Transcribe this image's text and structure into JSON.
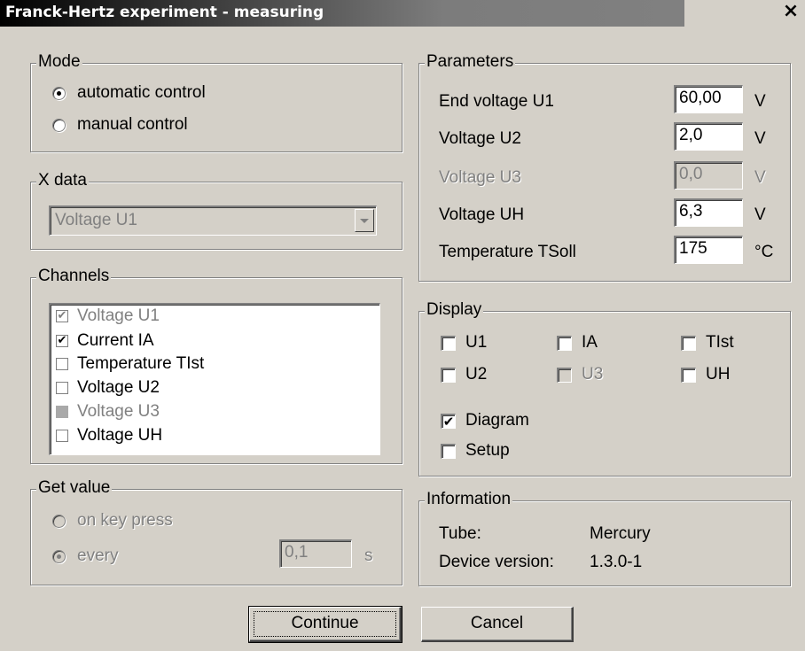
{
  "window": {
    "title": "Franck-Hertz experiment - measuring",
    "close_glyph": "×"
  },
  "mode": {
    "label": "Mode",
    "options": [
      {
        "label": "automatic control",
        "selected": true
      },
      {
        "label": "manual control",
        "selected": false
      }
    ]
  },
  "xdata": {
    "label": "X data",
    "value": "Voltage U1"
  },
  "channels": {
    "label": "Channels",
    "items": [
      {
        "label": "Voltage U1",
        "checked": true,
        "state": "disabled"
      },
      {
        "label": "Current IA",
        "checked": true,
        "state": "enabled"
      },
      {
        "label": "Temperature TIst",
        "checked": false,
        "state": "enabled"
      },
      {
        "label": "Voltage U2",
        "checked": false,
        "state": "enabled"
      },
      {
        "label": "Voltage U3",
        "checked": false,
        "state": "greyed"
      },
      {
        "label": "Voltage UH",
        "checked": false,
        "state": "enabled"
      }
    ]
  },
  "getvalue": {
    "label": "Get value",
    "on_key_press": "on key press",
    "every": "every",
    "interval": "0,1",
    "unit": "s"
  },
  "parameters": {
    "label": "Parameters",
    "rows": [
      {
        "label": "End voltage U1",
        "value": "60,00",
        "unit": "V",
        "enabled": true
      },
      {
        "label": "Voltage U2",
        "value": "2,0",
        "unit": "V",
        "enabled": true
      },
      {
        "label": "Voltage U3",
        "value": "0,0",
        "unit": "V",
        "enabled": false
      },
      {
        "label": "Voltage UH",
        "value": "6,3",
        "unit": "V",
        "enabled": true
      },
      {
        "label": "Temperature TSoll",
        "value": "175",
        "unit": "°C",
        "enabled": true
      }
    ]
  },
  "display": {
    "label": "Display",
    "checks": [
      {
        "label": "U1",
        "checked": false,
        "enabled": true
      },
      {
        "label": "IA",
        "checked": false,
        "enabled": true
      },
      {
        "label": "TIst",
        "checked": false,
        "enabled": true
      },
      {
        "label": "U2",
        "checked": false,
        "enabled": true
      },
      {
        "label": "U3",
        "checked": false,
        "enabled": false
      },
      {
        "label": "UH",
        "checked": false,
        "enabled": true
      }
    ],
    "diagram": {
      "label": "Diagram",
      "checked": true
    },
    "setup": {
      "label": "Setup",
      "checked": false
    }
  },
  "information": {
    "label": "Information",
    "tube_label": "Tube:",
    "tube_value": "Mercury",
    "version_label": "Device version:",
    "version_value": "1.3.0-1"
  },
  "buttons": {
    "continue": "Continue",
    "cancel": "Cancel"
  },
  "check_glyph": "✔"
}
